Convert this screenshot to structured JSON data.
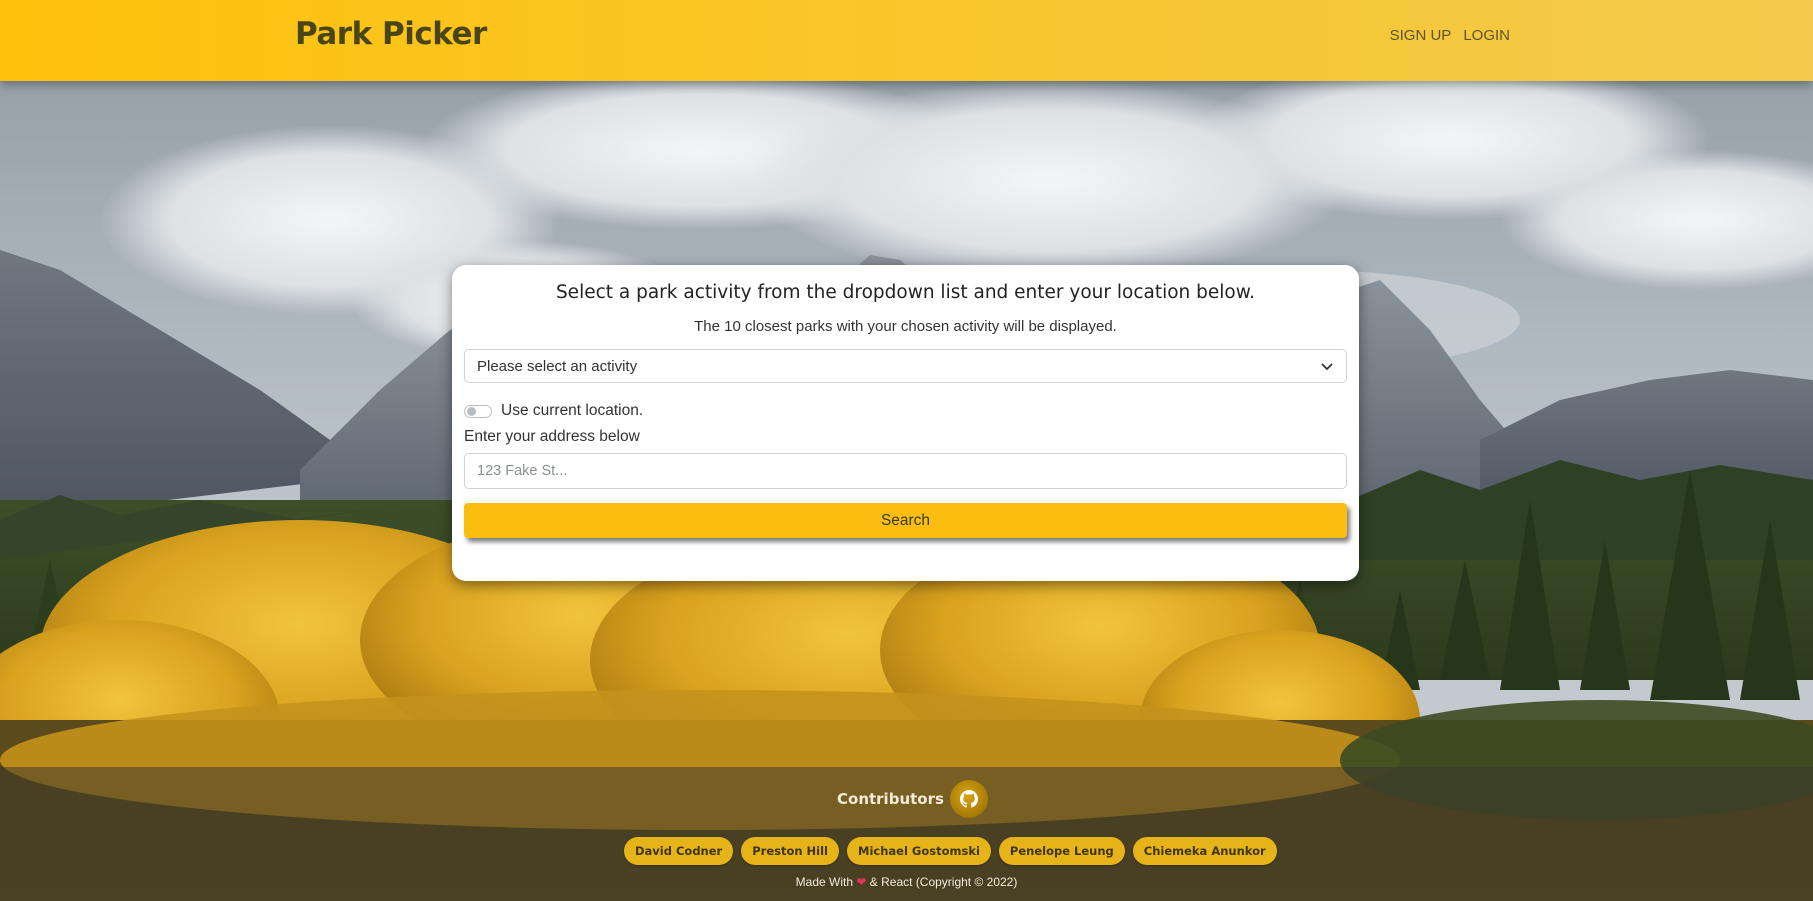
{
  "header": {
    "brand": "Park Picker",
    "nav": [
      "SIGN UP",
      "LOGIN"
    ],
    "accent_color": "#ffc20c"
  },
  "search_card": {
    "title": "Select a park activity from the dropdown list and enter your location below.",
    "subtitle": "The 10 closest parks with your chosen activity will be displayed.",
    "activity_select": {
      "selected": "Please select an activity",
      "icon": "chevron-down-icon"
    },
    "use_location": {
      "label": "Use current location.",
      "checked": false
    },
    "address_label": "Enter your address below",
    "address_input": {
      "value": "",
      "placeholder": "123 Fake St..."
    },
    "search_button": "Search",
    "button_color": "#fbbe10"
  },
  "footer": {
    "contributors_label": "Contributors",
    "github_icon": "github-icon",
    "contributors": [
      "David Codner",
      "Preston Hill",
      "Michael Gostomski",
      "Penelope Leung",
      "Chiemeka Anunkor"
    ],
    "made_with_prefix": "Made With",
    "made_with_suffix": "& React (Copyright © 2022)"
  }
}
